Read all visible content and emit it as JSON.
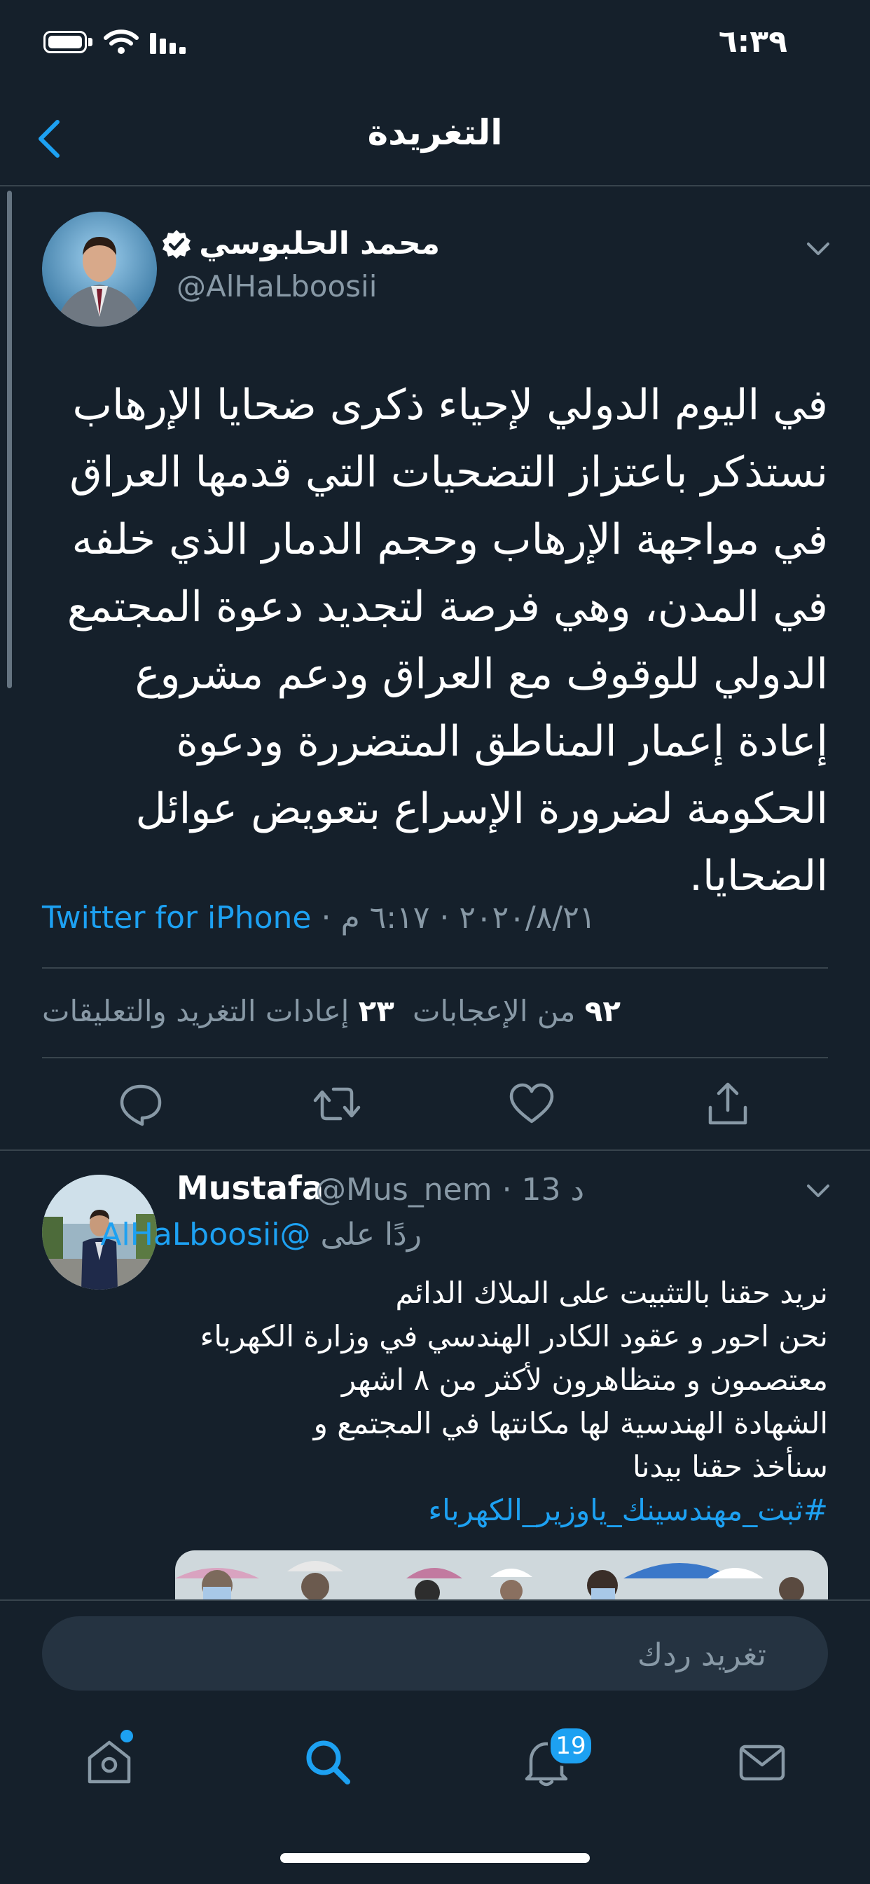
{
  "status_bar": {
    "time": "٦:٣٩"
  },
  "header": {
    "title": "التغريدة"
  },
  "tweet": {
    "author_name": "محمد الحلبوسي",
    "author_handle": "@AlHaLboosii",
    "text": "في اليوم الدولي لإحياء ذكرى ضحايا الإرهاب نستذكر باعتزاز التضحيات التي قدمها العراق في مواجهة الإرهاب وحجم الدمار الذي خلفه في المدن، وهي فرصة لتجديد دعوة المجتمع الدولي للوقوف مع العراق ودعم مشروع إعادة إعمار المناطق المتضررة ودعوة الحكومة لضرورة الإسراع بتعويض عوائل الضحايا.",
    "source": "Twitter for iPhone",
    "timestamp": " · ٢٠٢٠/٨/٢١ · ٦:١٧ م",
    "likes_count": "٩٢",
    "likes_label": "من الإعجابات",
    "retweets_count": "٢٣",
    "retweets_label": "إعادات التغريد والتعليقات"
  },
  "reply": {
    "author_name": "Mustafa",
    "author_handle": "@Mus_nem · 13 د",
    "reply_to_label": "ردًا على",
    "reply_to_handle": "@AlHaLboosii",
    "lines": [
      "نريد حقنا بالتثبيت على الملاك الدائم",
      "نحن احور و عقود الكادر الهندسي في وزارة الكهرباء",
      "معتصمون و متظاهرون لأكثر من ٨ اشهر",
      "الشهادة الهندسية لها مكانتها في المجتمع و",
      "سنأخذ حقنا بيدنا"
    ],
    "hashtag": "#ثبت_مهندسينك_ياوزير_الكهرباء"
  },
  "compose": {
    "placeholder": "تغريد ردك"
  },
  "tabbar": {
    "notifications_badge": "19"
  },
  "colors": {
    "background": "#15202b",
    "accent": "#1da1f2",
    "secondary_text": "#8899a6",
    "divider": "#38444d"
  }
}
